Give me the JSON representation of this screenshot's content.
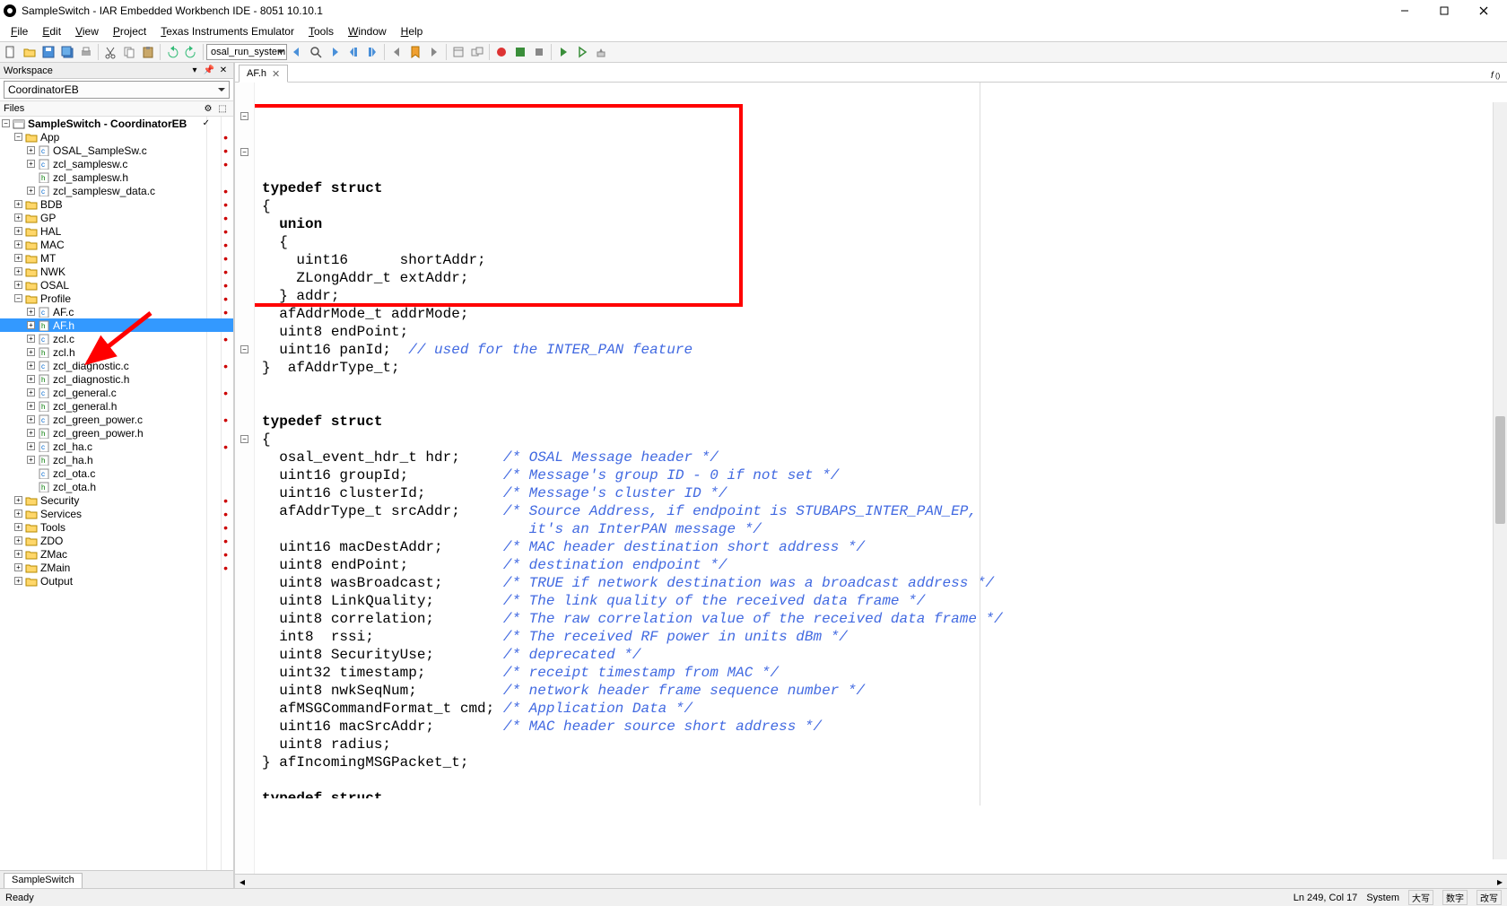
{
  "window": {
    "title": "SampleSwitch - IAR Embedded Workbench IDE - 8051 10.10.1"
  },
  "menu": [
    "File",
    "Edit",
    "View",
    "Project",
    "Texas Instruments Emulator",
    "Tools",
    "Window",
    "Help"
  ],
  "toolbar": {
    "combo_value": "osal_run_system"
  },
  "workspace": {
    "panel_title": "Workspace",
    "config_selected": "CoordinatorEB",
    "files_label": "Files",
    "bottom_tab": "SampleSwitch",
    "tree": [
      {
        "l": 0,
        "e": "-",
        "icon": "proj",
        "name": "SampleSwitch - CoordinatorEB",
        "bold": true,
        "check": true
      },
      {
        "l": 1,
        "e": "-",
        "icon": "fld",
        "name": "App",
        "dot": true
      },
      {
        "l": 2,
        "e": "+",
        "icon": "c",
        "name": "OSAL_SampleSw.c",
        "dot": true
      },
      {
        "l": 2,
        "e": "+",
        "icon": "c",
        "name": "zcl_samplesw.c",
        "dot": true
      },
      {
        "l": 2,
        "e": " ",
        "icon": "h",
        "name": "zcl_samplesw.h"
      },
      {
        "l": 2,
        "e": "+",
        "icon": "c",
        "name": "zcl_samplesw_data.c",
        "dot": true
      },
      {
        "l": 1,
        "e": "+",
        "icon": "fld",
        "name": "BDB",
        "dot": true
      },
      {
        "l": 1,
        "e": "+",
        "icon": "fld",
        "name": "GP",
        "dot": true
      },
      {
        "l": 1,
        "e": "+",
        "icon": "fld",
        "name": "HAL",
        "dot": true
      },
      {
        "l": 1,
        "e": "+",
        "icon": "fld",
        "name": "MAC",
        "dot": true
      },
      {
        "l": 1,
        "e": "+",
        "icon": "fld",
        "name": "MT",
        "dot": true
      },
      {
        "l": 1,
        "e": "+",
        "icon": "fld",
        "name": "NWK",
        "dot": true
      },
      {
        "l": 1,
        "e": "+",
        "icon": "fld",
        "name": "OSAL",
        "dot": true
      },
      {
        "l": 1,
        "e": "-",
        "icon": "fld",
        "name": "Profile",
        "dot": true
      },
      {
        "l": 2,
        "e": "+",
        "icon": "c",
        "name": "AF.c",
        "dot": true
      },
      {
        "l": 2,
        "e": "+",
        "icon": "h",
        "name": "AF.h",
        "selected": true
      },
      {
        "l": 2,
        "e": "+",
        "icon": "c",
        "name": "zcl.c",
        "dot": true
      },
      {
        "l": 2,
        "e": "+",
        "icon": "h",
        "name": "zcl.h"
      },
      {
        "l": 2,
        "e": "+",
        "icon": "c",
        "name": "zcl_diagnostic.c",
        "dot": true
      },
      {
        "l": 2,
        "e": "+",
        "icon": "h",
        "name": "zcl_diagnostic.h"
      },
      {
        "l": 2,
        "e": "+",
        "icon": "c",
        "name": "zcl_general.c",
        "dot": true
      },
      {
        "l": 2,
        "e": "+",
        "icon": "h",
        "name": "zcl_general.h"
      },
      {
        "l": 2,
        "e": "+",
        "icon": "c",
        "name": "zcl_green_power.c",
        "dot": true
      },
      {
        "l": 2,
        "e": "+",
        "icon": "h",
        "name": "zcl_green_power.h"
      },
      {
        "l": 2,
        "e": "+",
        "icon": "c",
        "name": "zcl_ha.c",
        "dot": true
      },
      {
        "l": 2,
        "e": "+",
        "icon": "h",
        "name": "zcl_ha.h"
      },
      {
        "l": 2,
        "e": " ",
        "icon": "c",
        "name": "zcl_ota.c"
      },
      {
        "l": 2,
        "e": " ",
        "icon": "h",
        "name": "zcl_ota.h"
      },
      {
        "l": 1,
        "e": "+",
        "icon": "fld",
        "name": "Security",
        "dot": true
      },
      {
        "l": 1,
        "e": "+",
        "icon": "fld",
        "name": "Services",
        "dot": true
      },
      {
        "l": 1,
        "e": "+",
        "icon": "fld",
        "name": "Tools",
        "dot": true
      },
      {
        "l": 1,
        "e": "+",
        "icon": "fld",
        "name": "ZDO",
        "dot": true
      },
      {
        "l": 1,
        "e": "+",
        "icon": "fld",
        "name": "ZMac",
        "dot": true
      },
      {
        "l": 1,
        "e": "+",
        "icon": "fld",
        "name": "ZMain",
        "dot": true
      },
      {
        "l": 1,
        "e": "+",
        "icon": "fld",
        "name": "Output"
      }
    ]
  },
  "editor": {
    "tab_name": "AF.h",
    "code_lines": [
      {
        "t": "typedef struct",
        "kw": [
          0,
          14
        ]
      },
      {
        "t": "{"
      },
      {
        "t": "  union",
        "kw": [
          2,
          7
        ]
      },
      {
        "t": "  {"
      },
      {
        "t": "    uint16      shortAddr;"
      },
      {
        "t": "    ZLongAddr_t extAddr;"
      },
      {
        "t": "  } addr;"
      },
      {
        "t": "  afAddrMode_t addrMode;"
      },
      {
        "t": "  uint8 endPoint;"
      },
      {
        "t": "  uint16 panId;  // used for the INTER_PAN feature",
        "cm": [
          17,
          50
        ]
      },
      {
        "t": "}  afAddrType_t;"
      },
      {
        "t": ""
      },
      {
        "t": ""
      },
      {
        "t": "typedef struct",
        "kw": [
          0,
          14
        ]
      },
      {
        "t": "{"
      },
      {
        "t": "  osal_event_hdr_t hdr;     /* OSAL Message header */",
        "cm": [
          28,
          53
        ]
      },
      {
        "t": "  uint16 groupId;           /* Message's group ID - 0 if not set */",
        "cm": [
          28,
          67
        ]
      },
      {
        "t": "  uint16 clusterId;         /* Message's cluster ID */",
        "cm": [
          28,
          54
        ]
      },
      {
        "t": "  afAddrType_t srcAddr;     /* Source Address, if endpoint is STUBAPS_INTER_PAN_EP,",
        "cm": [
          28,
          83
        ]
      },
      {
        "t": "                               it's an InterPAN message */",
        "cm": [
          0,
          58
        ]
      },
      {
        "t": "  uint16 macDestAddr;       /* MAC header destination short address */",
        "cm": [
          28,
          70
        ]
      },
      {
        "t": "  uint8 endPoint;           /* destination endpoint */",
        "cm": [
          28,
          54
        ]
      },
      {
        "t": "  uint8 wasBroadcast;       /* TRUE if network destination was a broadcast address */",
        "cm": [
          28,
          85
        ]
      },
      {
        "t": "  uint8 LinkQuality;        /* The link quality of the received data frame */",
        "cm": [
          28,
          77
        ]
      },
      {
        "t": "  uint8 correlation;        /* The raw correlation value of the received data frame */",
        "cm": [
          28,
          86
        ]
      },
      {
        "t": "  int8  rssi;               /* The received RF power in units dBm */",
        "cm": [
          28,
          68
        ]
      },
      {
        "t": "  uint8 SecurityUse;        /* deprecated */",
        "cm": [
          28,
          44
        ]
      },
      {
        "t": "  uint32 timestamp;         /* receipt timestamp from MAC */",
        "cm": [
          28,
          60
        ]
      },
      {
        "t": "  uint8 nwkSeqNum;          /* network header frame sequence number */",
        "cm": [
          28,
          70
        ]
      },
      {
        "t": "  afMSGCommandFormat_t cmd; /* Application Data */",
        "cm": [
          28,
          50
        ]
      },
      {
        "t": "  uint16 macSrcAddr;        /* MAC header source short address */",
        "cm": [
          28,
          65
        ]
      },
      {
        "t": "  uint8 radius;"
      },
      {
        "t": "} afIncomingMSGPacket_t;"
      },
      {
        "t": ""
      },
      {
        "t": "typedef struct",
        "kw": [
          0,
          14
        ],
        "cut": true
      }
    ]
  },
  "status": {
    "left": "Ready",
    "pos": "Ln 249, Col 17",
    "mode": "System",
    "ime1": "大写",
    "ime2": "数字",
    "ime3": "改写"
  }
}
